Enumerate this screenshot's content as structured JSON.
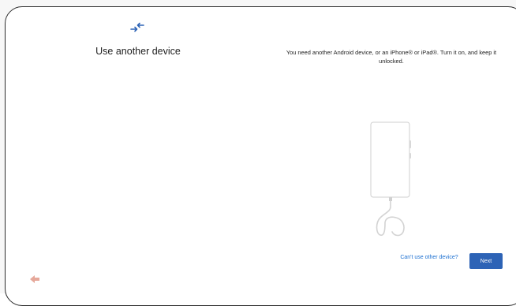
{
  "page": {
    "title": "Use another device",
    "description": "You need another Android device, or an iPhone® or iPad®. Turn it on, and keep it unlocked."
  },
  "icons": {
    "header": "data-transfer-arrows-icon",
    "back": "back-arrow-icon"
  },
  "illustration": "phone-with-cable-illustration",
  "actions": {
    "secondary_label": "Can't use other device?",
    "next_label": "Next"
  },
  "colors": {
    "accent": "#2d63b6",
    "link": "#1b6fd1",
    "back_icon": "#e6a89a"
  }
}
